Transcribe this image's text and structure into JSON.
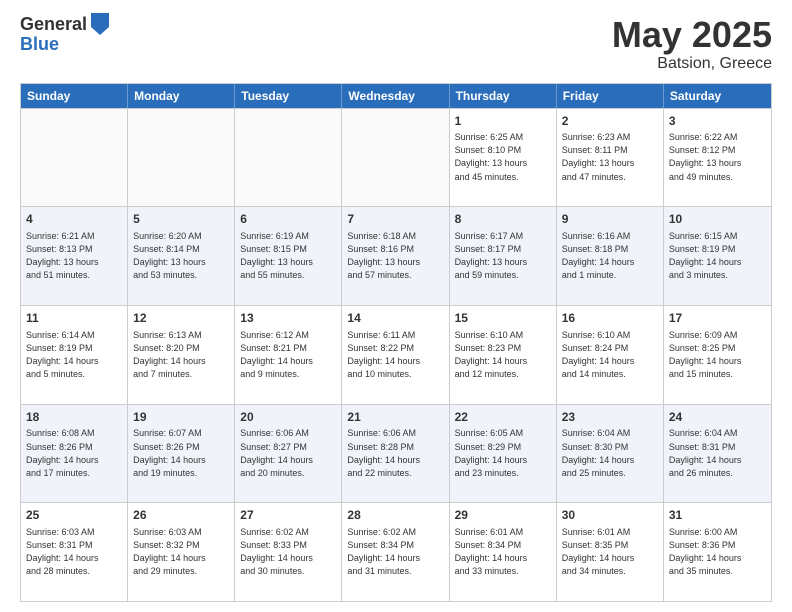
{
  "header": {
    "logo_general": "General",
    "logo_blue": "Blue",
    "month": "May 2025",
    "location": "Batsion, Greece"
  },
  "weekdays": [
    "Sunday",
    "Monday",
    "Tuesday",
    "Wednesday",
    "Thursday",
    "Friday",
    "Saturday"
  ],
  "rows": [
    [
      {
        "day": "",
        "info": ""
      },
      {
        "day": "",
        "info": ""
      },
      {
        "day": "",
        "info": ""
      },
      {
        "day": "",
        "info": ""
      },
      {
        "day": "1",
        "info": "Sunrise: 6:25 AM\nSunset: 8:10 PM\nDaylight: 13 hours\nand 45 minutes."
      },
      {
        "day": "2",
        "info": "Sunrise: 6:23 AM\nSunset: 8:11 PM\nDaylight: 13 hours\nand 47 minutes."
      },
      {
        "day": "3",
        "info": "Sunrise: 6:22 AM\nSunset: 8:12 PM\nDaylight: 13 hours\nand 49 minutes."
      }
    ],
    [
      {
        "day": "4",
        "info": "Sunrise: 6:21 AM\nSunset: 8:13 PM\nDaylight: 13 hours\nand 51 minutes."
      },
      {
        "day": "5",
        "info": "Sunrise: 6:20 AM\nSunset: 8:14 PM\nDaylight: 13 hours\nand 53 minutes."
      },
      {
        "day": "6",
        "info": "Sunrise: 6:19 AM\nSunset: 8:15 PM\nDaylight: 13 hours\nand 55 minutes."
      },
      {
        "day": "7",
        "info": "Sunrise: 6:18 AM\nSunset: 8:16 PM\nDaylight: 13 hours\nand 57 minutes."
      },
      {
        "day": "8",
        "info": "Sunrise: 6:17 AM\nSunset: 8:17 PM\nDaylight: 13 hours\nand 59 minutes."
      },
      {
        "day": "9",
        "info": "Sunrise: 6:16 AM\nSunset: 8:18 PM\nDaylight: 14 hours\nand 1 minute."
      },
      {
        "day": "10",
        "info": "Sunrise: 6:15 AM\nSunset: 8:19 PM\nDaylight: 14 hours\nand 3 minutes."
      }
    ],
    [
      {
        "day": "11",
        "info": "Sunrise: 6:14 AM\nSunset: 8:19 PM\nDaylight: 14 hours\nand 5 minutes."
      },
      {
        "day": "12",
        "info": "Sunrise: 6:13 AM\nSunset: 8:20 PM\nDaylight: 14 hours\nand 7 minutes."
      },
      {
        "day": "13",
        "info": "Sunrise: 6:12 AM\nSunset: 8:21 PM\nDaylight: 14 hours\nand 9 minutes."
      },
      {
        "day": "14",
        "info": "Sunrise: 6:11 AM\nSunset: 8:22 PM\nDaylight: 14 hours\nand 10 minutes."
      },
      {
        "day": "15",
        "info": "Sunrise: 6:10 AM\nSunset: 8:23 PM\nDaylight: 14 hours\nand 12 minutes."
      },
      {
        "day": "16",
        "info": "Sunrise: 6:10 AM\nSunset: 8:24 PM\nDaylight: 14 hours\nand 14 minutes."
      },
      {
        "day": "17",
        "info": "Sunrise: 6:09 AM\nSunset: 8:25 PM\nDaylight: 14 hours\nand 15 minutes."
      }
    ],
    [
      {
        "day": "18",
        "info": "Sunrise: 6:08 AM\nSunset: 8:26 PM\nDaylight: 14 hours\nand 17 minutes."
      },
      {
        "day": "19",
        "info": "Sunrise: 6:07 AM\nSunset: 8:26 PM\nDaylight: 14 hours\nand 19 minutes."
      },
      {
        "day": "20",
        "info": "Sunrise: 6:06 AM\nSunset: 8:27 PM\nDaylight: 14 hours\nand 20 minutes."
      },
      {
        "day": "21",
        "info": "Sunrise: 6:06 AM\nSunset: 8:28 PM\nDaylight: 14 hours\nand 22 minutes."
      },
      {
        "day": "22",
        "info": "Sunrise: 6:05 AM\nSunset: 8:29 PM\nDaylight: 14 hours\nand 23 minutes."
      },
      {
        "day": "23",
        "info": "Sunrise: 6:04 AM\nSunset: 8:30 PM\nDaylight: 14 hours\nand 25 minutes."
      },
      {
        "day": "24",
        "info": "Sunrise: 6:04 AM\nSunset: 8:31 PM\nDaylight: 14 hours\nand 26 minutes."
      }
    ],
    [
      {
        "day": "25",
        "info": "Sunrise: 6:03 AM\nSunset: 8:31 PM\nDaylight: 14 hours\nand 28 minutes."
      },
      {
        "day": "26",
        "info": "Sunrise: 6:03 AM\nSunset: 8:32 PM\nDaylight: 14 hours\nand 29 minutes."
      },
      {
        "day": "27",
        "info": "Sunrise: 6:02 AM\nSunset: 8:33 PM\nDaylight: 14 hours\nand 30 minutes."
      },
      {
        "day": "28",
        "info": "Sunrise: 6:02 AM\nSunset: 8:34 PM\nDaylight: 14 hours\nand 31 minutes."
      },
      {
        "day": "29",
        "info": "Sunrise: 6:01 AM\nSunset: 8:34 PM\nDaylight: 14 hours\nand 33 minutes."
      },
      {
        "day": "30",
        "info": "Sunrise: 6:01 AM\nSunset: 8:35 PM\nDaylight: 14 hours\nand 34 minutes."
      },
      {
        "day": "31",
        "info": "Sunrise: 6:00 AM\nSunset: 8:36 PM\nDaylight: 14 hours\nand 35 minutes."
      }
    ]
  ]
}
